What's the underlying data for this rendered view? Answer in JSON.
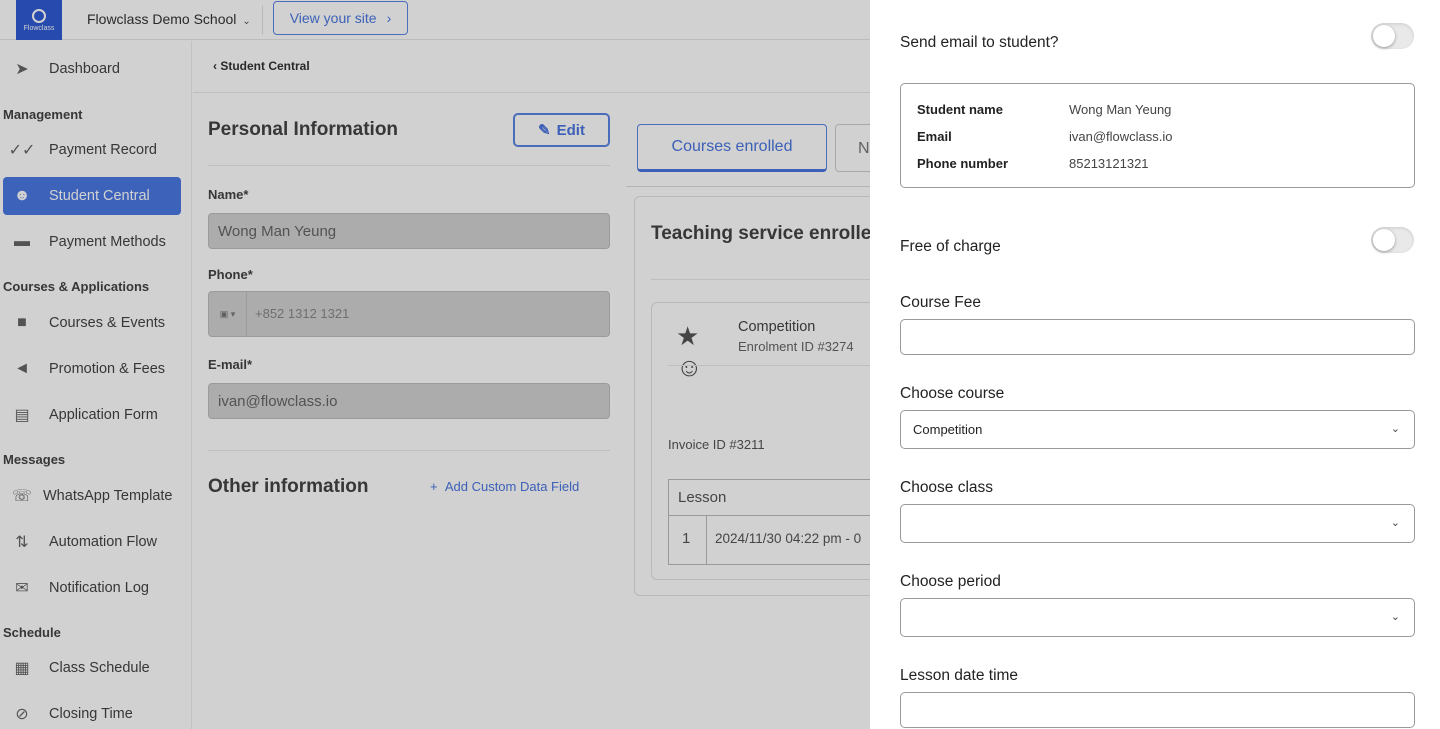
{
  "topbar": {
    "logo_text": "Flowclass",
    "school_name": "Flowclass Demo School",
    "view_site": "View your site"
  },
  "sidebar": {
    "dashboard": "Dashboard",
    "sections": {
      "management": "Management",
      "courses": "Courses & Applications",
      "messages": "Messages",
      "schedule": "Schedule"
    },
    "items": {
      "payment_record": "Payment Record",
      "student_central": "Student Central",
      "payment_methods": "Payment Methods",
      "courses_events": "Courses & Events",
      "promotion_fees": "Promotion & Fees",
      "application_form": "Application Form",
      "whatsapp_template": "WhatsApp Template",
      "automation_flow": "Automation Flow",
      "notification_log": "Notification Log",
      "class_schedule": "Class Schedule",
      "closing_time": "Closing Time"
    }
  },
  "main": {
    "breadcrumb": "Student Central",
    "personal_info_title": "Personal Information",
    "edit_label": "Edit",
    "name_label": "Name*",
    "name_value": "Wong Man Yeung",
    "phone_label": "Phone*",
    "phone_value": "+852 1312 1321",
    "email_label": "E-mail*",
    "email_value": "ivan@flowclass.io",
    "other_info_title": "Other information",
    "add_custom_field": "Add Custom Data Field",
    "tab_courses": "Courses enrolled",
    "tab_next": "N",
    "teaching_title": "Teaching service enrolled",
    "competition_name": "Competition",
    "enrolment_id": "Enrolment ID #3274",
    "invoice_id": "Invoice ID #3211",
    "lesson_header": "Lesson",
    "lesson_num": "1",
    "lesson_date": "2024/11/30 04:22 pm - 0"
  },
  "drawer": {
    "send_email_label": "Send email to student?",
    "send_email_on": false,
    "student_name_key": "Student name",
    "student_name_val": "Wong Man Yeung",
    "email_key": "Email",
    "email_val": "ivan@flowclass.io",
    "phone_key": "Phone number",
    "phone_val": "85213121321",
    "free_label": "Free of charge",
    "free_on": false,
    "course_fee_label": "Course Fee",
    "course_fee_value": "",
    "choose_course_label": "Choose course",
    "choose_course_value": "Competition",
    "choose_class_label": "Choose class",
    "choose_class_value": "",
    "choose_period_label": "Choose period",
    "choose_period_value": "",
    "lesson_datetime_label": "Lesson date time",
    "lesson_datetime_value": ""
  },
  "colors": {
    "accent": "#4a76e0",
    "active_nav": "#4a78e3"
  }
}
